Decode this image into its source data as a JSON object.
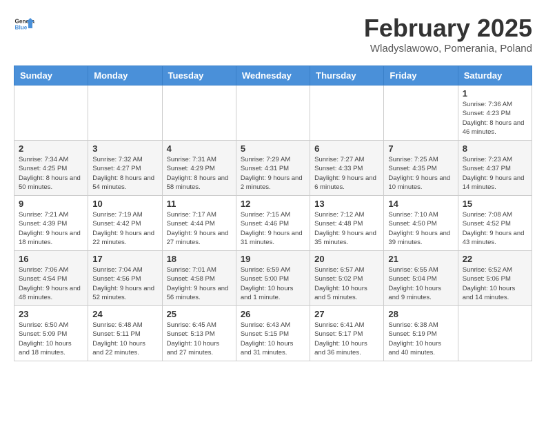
{
  "header": {
    "logo_general": "General",
    "logo_blue": "Blue",
    "month_year": "February 2025",
    "location": "Wladyslawowo, Pomerania, Poland"
  },
  "weekdays": [
    "Sunday",
    "Monday",
    "Tuesday",
    "Wednesday",
    "Thursday",
    "Friday",
    "Saturday"
  ],
  "weeks": [
    [
      {
        "day": "",
        "detail": ""
      },
      {
        "day": "",
        "detail": ""
      },
      {
        "day": "",
        "detail": ""
      },
      {
        "day": "",
        "detail": ""
      },
      {
        "day": "",
        "detail": ""
      },
      {
        "day": "",
        "detail": ""
      },
      {
        "day": "1",
        "detail": "Sunrise: 7:36 AM\nSunset: 4:23 PM\nDaylight: 8 hours and 46 minutes."
      }
    ],
    [
      {
        "day": "2",
        "detail": "Sunrise: 7:34 AM\nSunset: 4:25 PM\nDaylight: 8 hours and 50 minutes."
      },
      {
        "day": "3",
        "detail": "Sunrise: 7:32 AM\nSunset: 4:27 PM\nDaylight: 8 hours and 54 minutes."
      },
      {
        "day": "4",
        "detail": "Sunrise: 7:31 AM\nSunset: 4:29 PM\nDaylight: 8 hours and 58 minutes."
      },
      {
        "day": "5",
        "detail": "Sunrise: 7:29 AM\nSunset: 4:31 PM\nDaylight: 9 hours and 2 minutes."
      },
      {
        "day": "6",
        "detail": "Sunrise: 7:27 AM\nSunset: 4:33 PM\nDaylight: 9 hours and 6 minutes."
      },
      {
        "day": "7",
        "detail": "Sunrise: 7:25 AM\nSunset: 4:35 PM\nDaylight: 9 hours and 10 minutes."
      },
      {
        "day": "8",
        "detail": "Sunrise: 7:23 AM\nSunset: 4:37 PM\nDaylight: 9 hours and 14 minutes."
      }
    ],
    [
      {
        "day": "9",
        "detail": "Sunrise: 7:21 AM\nSunset: 4:39 PM\nDaylight: 9 hours and 18 minutes."
      },
      {
        "day": "10",
        "detail": "Sunrise: 7:19 AM\nSunset: 4:42 PM\nDaylight: 9 hours and 22 minutes."
      },
      {
        "day": "11",
        "detail": "Sunrise: 7:17 AM\nSunset: 4:44 PM\nDaylight: 9 hours and 27 minutes."
      },
      {
        "day": "12",
        "detail": "Sunrise: 7:15 AM\nSunset: 4:46 PM\nDaylight: 9 hours and 31 minutes."
      },
      {
        "day": "13",
        "detail": "Sunrise: 7:12 AM\nSunset: 4:48 PM\nDaylight: 9 hours and 35 minutes."
      },
      {
        "day": "14",
        "detail": "Sunrise: 7:10 AM\nSunset: 4:50 PM\nDaylight: 9 hours and 39 minutes."
      },
      {
        "day": "15",
        "detail": "Sunrise: 7:08 AM\nSunset: 4:52 PM\nDaylight: 9 hours and 43 minutes."
      }
    ],
    [
      {
        "day": "16",
        "detail": "Sunrise: 7:06 AM\nSunset: 4:54 PM\nDaylight: 9 hours and 48 minutes."
      },
      {
        "day": "17",
        "detail": "Sunrise: 7:04 AM\nSunset: 4:56 PM\nDaylight: 9 hours and 52 minutes."
      },
      {
        "day": "18",
        "detail": "Sunrise: 7:01 AM\nSunset: 4:58 PM\nDaylight: 9 hours and 56 minutes."
      },
      {
        "day": "19",
        "detail": "Sunrise: 6:59 AM\nSunset: 5:00 PM\nDaylight: 10 hours and 1 minute."
      },
      {
        "day": "20",
        "detail": "Sunrise: 6:57 AM\nSunset: 5:02 PM\nDaylight: 10 hours and 5 minutes."
      },
      {
        "day": "21",
        "detail": "Sunrise: 6:55 AM\nSunset: 5:04 PM\nDaylight: 10 hours and 9 minutes."
      },
      {
        "day": "22",
        "detail": "Sunrise: 6:52 AM\nSunset: 5:06 PM\nDaylight: 10 hours and 14 minutes."
      }
    ],
    [
      {
        "day": "23",
        "detail": "Sunrise: 6:50 AM\nSunset: 5:09 PM\nDaylight: 10 hours and 18 minutes."
      },
      {
        "day": "24",
        "detail": "Sunrise: 6:48 AM\nSunset: 5:11 PM\nDaylight: 10 hours and 22 minutes."
      },
      {
        "day": "25",
        "detail": "Sunrise: 6:45 AM\nSunset: 5:13 PM\nDaylight: 10 hours and 27 minutes."
      },
      {
        "day": "26",
        "detail": "Sunrise: 6:43 AM\nSunset: 5:15 PM\nDaylight: 10 hours and 31 minutes."
      },
      {
        "day": "27",
        "detail": "Sunrise: 6:41 AM\nSunset: 5:17 PM\nDaylight: 10 hours and 36 minutes."
      },
      {
        "day": "28",
        "detail": "Sunrise: 6:38 AM\nSunset: 5:19 PM\nDaylight: 10 hours and 40 minutes."
      },
      {
        "day": "",
        "detail": ""
      }
    ]
  ]
}
